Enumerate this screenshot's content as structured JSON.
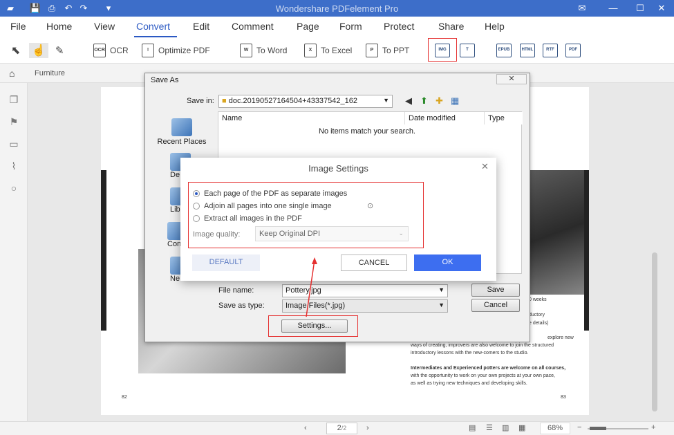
{
  "window": {
    "title": "Wondershare PDFelement Pro"
  },
  "menu": {
    "items": [
      "File",
      "Home",
      "View",
      "Convert",
      "Edit",
      "Comment",
      "Page",
      "Form",
      "Protect",
      "Share",
      "Help"
    ],
    "active": "Convert"
  },
  "toolbar": {
    "ocr": "OCR",
    "optimize_pdf": "Optimize PDF",
    "to_word": "To Word",
    "to_excel": "To Excel",
    "to_ppt": "To PPT",
    "icons": [
      "select-icon",
      "hand-icon",
      "edit-icon",
      "ocr-icon",
      "optimize-icon",
      "word-icon",
      "excel-icon",
      "ppt-icon",
      "to-image-icon",
      "to-text-icon",
      "to-epub-icon",
      "to-html-icon",
      "to-rtf-icon",
      "to-pdfa-icon"
    ]
  },
  "tab": {
    "label": "Furniture"
  },
  "save_as": {
    "title": "Save As",
    "save_in_label": "Save in:",
    "save_in_value": "doc.20190527164504+43337542_162",
    "columns": [
      "Name",
      "Date modified",
      "Type"
    ],
    "empty_message": "No items match your search.",
    "places": [
      "Recent Places",
      "De",
      "Lib",
      "Con",
      "Ne"
    ],
    "file_name_label": "File name:",
    "file_name_value": "Pottery.jpg",
    "save_type_label": "Save as type:",
    "save_type_value": "Image Files(*.jpg)",
    "save_button": "Save",
    "cancel_button": "Cancel",
    "settings_button": "Settings...",
    "close": "✕"
  },
  "image_settings": {
    "title": "Image Settings",
    "options": [
      {
        "label": "Each page of the PDF as separate images",
        "selected": true
      },
      {
        "label": "Adjoin all pages into one single image",
        "selected": false
      },
      {
        "label": "Extract all images in the PDF",
        "selected": false
      }
    ],
    "quality_label": "Image quality:",
    "quality_value": "Keep Original DPI",
    "default_button": "DEFAULT",
    "cancel_button": "CANCEL",
    "ok_button": "OK",
    "accent": "#3d6ef0"
  },
  "page_content": {
    "left_page_number": "82",
    "right_page_number": "83",
    "right_text_1": "explore new",
    "right_text_2": "ways of creating, improvers are also welcome to join the structured",
    "right_text_3": "introductory lessons with the new-comers to the studio.",
    "right_text_4": "Intermediates and Experienced potters are welcome on all courses,",
    "right_text_5": "with the opportunity to work on your own projects at your own pace,",
    "right_text_6": "as well as trying new techniques and developing skills.",
    "weeks": "0 weeks",
    "ductory": "ductory",
    "details": "e details)"
  },
  "status": {
    "page_current": "2",
    "page_total": "/2",
    "zoom": "68%"
  },
  "colors": {
    "titlebar": "#3d6ec9",
    "highlight": "#e53030"
  }
}
